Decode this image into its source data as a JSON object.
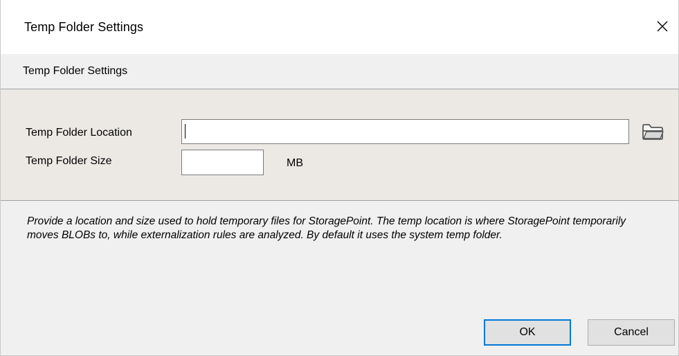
{
  "window": {
    "title": "Temp Folder Settings",
    "close_icon": "close-icon"
  },
  "header": {
    "title": "Temp Folder Settings"
  },
  "form": {
    "location_label": "Temp Folder Location",
    "location_value": "",
    "size_label": "Temp Folder Size",
    "size_value": "",
    "size_unit": "MB",
    "browse_icon": "folder-icon"
  },
  "description": "Provide a location and size used to hold temporary files for StoragePoint. The temp location is where StoragePoint temporarily moves BLOBs to, while externalization rules are analyzed. By default it uses the system temp folder.",
  "buttons": {
    "ok_label": "OK",
    "cancel_label": "Cancel"
  },
  "colors": {
    "accent": "#0078d7",
    "content_background": "#ece9e5",
    "dialog_background": "#f0f0f0"
  }
}
